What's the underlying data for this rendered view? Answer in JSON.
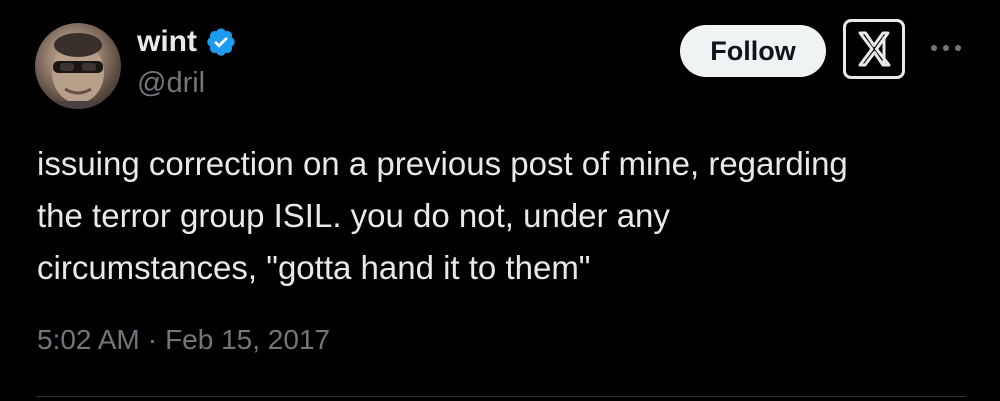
{
  "author": {
    "display_name": "wint",
    "handle": "@dril",
    "verified": true
  },
  "actions": {
    "follow_label": "Follow"
  },
  "tweet": {
    "text": "issuing correction on a previous post of mine, regarding\nthe terror group ISIL. you do not, under any\ncircumstances, \"gotta hand it to them\"",
    "time": "5:02 AM",
    "separator": "·",
    "date": "Feb 15, 2017"
  },
  "icons": {
    "verified": "verified-badge-icon",
    "logo": "x-logo-icon",
    "more": "more-options-icon"
  },
  "colors": {
    "background": "#000000",
    "text_primary": "#e7e9ea",
    "text_secondary": "#71767b",
    "verified_blue": "#1d9bf0",
    "follow_bg": "#eff3f4",
    "follow_text": "#0f1419"
  }
}
